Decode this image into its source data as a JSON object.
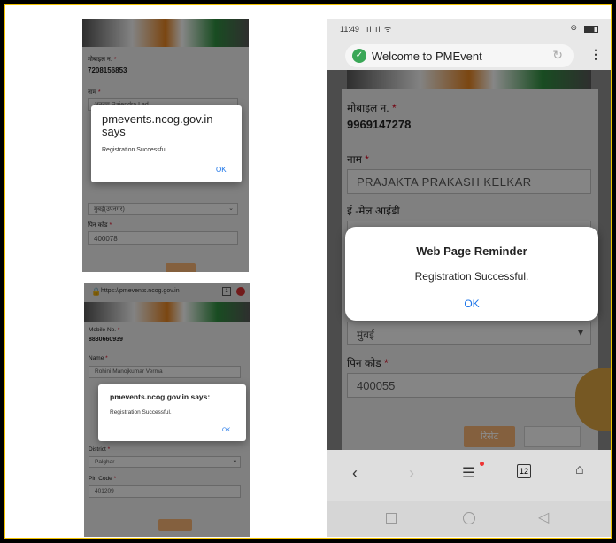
{
  "shot1": {
    "mobile_label": "मोबाइल न.",
    "mobile_value": "7208156853",
    "name_label": "नाम",
    "name_value": "अनुराग Rajendra Lad",
    "district_value": "मुंबई(उपनगर)",
    "pin_label": "पिन कोड",
    "pin_value": "400078",
    "dialog": {
      "title": "pmevents.ncog.gov.in says",
      "message": "Registration Successful.",
      "ok": "OK"
    }
  },
  "shot2": {
    "url": "https://pmevents.ncog.gov.in",
    "mobile_label": "Mobile No.",
    "mobile_value": "8830660939",
    "name_label": "Name",
    "name_value": "Rohini Manojkumar Verma",
    "district_label": "District",
    "district_value": "Palghar",
    "pin_label": "Pin Code",
    "pin_value": "401209",
    "dialog": {
      "title": "pmevents.ncog.gov.in says:",
      "message": "Registration Successful.",
      "ok": "OK"
    }
  },
  "shot3": {
    "status_time": "11:49",
    "tab_title": "Welcome to PMEvent",
    "mobile_label": "मोबाइल न.",
    "mobile_value": "9969147278",
    "name_label": "नाम",
    "name_value": "PRAJAKTA PRAKASH KELKAR",
    "email_label": "ई -मेल आईडी",
    "district_value": "मुंबई",
    "pin_label": "पिन कोड",
    "pin_value": "400055",
    "reset_label": "रिसेट",
    "tabs_count": "12",
    "dialog": {
      "title": "Web Page Reminder",
      "message": "Registration Successful.",
      "ok": "OK"
    }
  },
  "colors": {
    "frame_border": "#f2c200",
    "ok_blue": "#1a73e8",
    "star_red": "#d0021b",
    "reset_orange": "#f0b072"
  }
}
